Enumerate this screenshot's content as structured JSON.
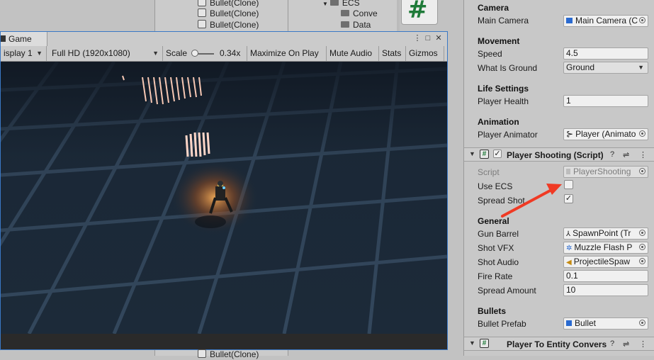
{
  "hierarchy": {
    "items": [
      "Bullet(Clone)",
      "Bullet(Clone)",
      "Bullet(Clone)"
    ],
    "bottom_item": "Bullet(Clone)"
  },
  "project": {
    "folders": [
      "ECS",
      "Conve",
      "Data"
    ]
  },
  "game_window": {
    "tab_label": "Game",
    "toolbar": {
      "display": "isplay 1",
      "resolution": "Full HD (1920x1080)",
      "scale_label": "Scale",
      "scale_value": "0.34x",
      "maximize": "Maximize On Play",
      "mute": "Mute Audio",
      "stats": "Stats",
      "gizmos": "Gizmos"
    }
  },
  "inspector": {
    "camera": {
      "header": "Camera",
      "main_camera_label": "Main Camera",
      "main_camera_value": "Main Camera (C"
    },
    "movement": {
      "header": "Movement",
      "speed_label": "Speed",
      "speed_value": "4.5",
      "ground_label": "What Is Ground",
      "ground_value": "Ground"
    },
    "life": {
      "header": "Life Settings",
      "health_label": "Player Health",
      "health_value": "1"
    },
    "animation": {
      "header": "Animation",
      "animator_label": "Player Animator",
      "animator_value": "Player (Animato"
    },
    "shooting": {
      "title": "Player Shooting (Script)",
      "script_label": "Script",
      "script_value": "PlayerShooting",
      "use_ecs_label": "Use ECS",
      "use_ecs_checked": false,
      "spread_label": "Spread Shot",
      "spread_checked": true,
      "general_header": "General",
      "gun_barrel_label": "Gun Barrel",
      "gun_barrel_value": "SpawnPoint (Tr",
      "shot_vfx_label": "Shot VFX",
      "shot_vfx_value": "Muzzle Flash P",
      "shot_audio_label": "Shot Audio",
      "shot_audio_value": "ProjectileSpaw",
      "fire_rate_label": "Fire Rate",
      "fire_rate_value": "0.1",
      "spread_amount_label": "Spread Amount",
      "spread_amount_value": "10",
      "bullets_header": "Bullets",
      "bullet_prefab_label": "Bullet Prefab",
      "bullet_prefab_value": "Bullet"
    },
    "next_component": {
      "title": "Player To Entity Convers"
    }
  },
  "colors": {
    "script_icon": "#1e7a38",
    "annotation_arrow": "#f03a24",
    "game_border": "#3a78c5",
    "floor": "#1b2735"
  }
}
